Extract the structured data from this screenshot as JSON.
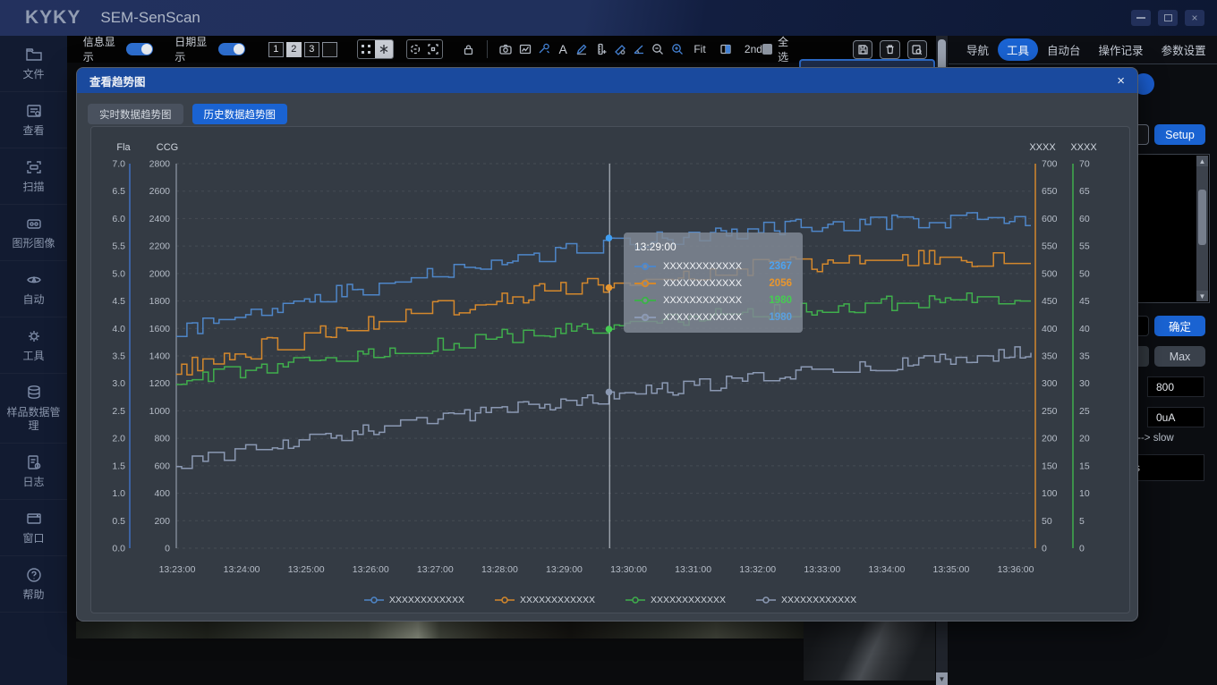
{
  "window": {
    "brand": "KYKY",
    "title": "SEM-SenScan",
    "close_icon": "×"
  },
  "toolbar": {
    "info_toggle_label": "信息显示",
    "date_toggle_label": "日期显示",
    "page_buttons": [
      "1",
      "2",
      "3",
      ""
    ],
    "text_tool_label": "A",
    "fit_label": "Fit",
    "second_label": "2nd",
    "select_all_label": "全选"
  },
  "sidebar": {
    "items": [
      {
        "label": "文件",
        "icon": "folder-icon"
      },
      {
        "label": "查看",
        "icon": "view-icon"
      },
      {
        "label": "扫描",
        "icon": "scan-icon"
      },
      {
        "label": "图形图像",
        "icon": "image-icon"
      },
      {
        "label": "自动",
        "icon": "auto-icon"
      },
      {
        "label": "工具",
        "icon": "gear-icon"
      },
      {
        "label": "样品数据管理",
        "icon": "database-icon"
      },
      {
        "label": "日志",
        "icon": "log-icon"
      },
      {
        "label": "窗口",
        "icon": "window-icon"
      },
      {
        "label": "帮助",
        "icon": "help-icon"
      }
    ]
  },
  "right_tabs": {
    "items": [
      "导航",
      "工具",
      "自动台",
      "操作记录",
      "参数设置"
    ],
    "active": "工具"
  },
  "right_panel": {
    "setup_label": "Setup",
    "confirm_label": "确定",
    "max_label": "Max",
    "voltage_value": "800",
    "current_value": "0uA",
    "slow_label": "-------> slow",
    "partial_input_value": "s",
    "scroll_up_icon": "▲",
    "scroll_down_icon": "▼"
  },
  "dialog": {
    "title": "查看趋势图",
    "close_icon": "×",
    "tabs": [
      {
        "label": "实时数据趋势图",
        "active": false
      },
      {
        "label": "历史数据趋势图",
        "active": true
      }
    ]
  },
  "chart_data": {
    "type": "line",
    "line_style": "step",
    "grid": "dashed-horizontal",
    "axes": {
      "left1": {
        "label": "Fla",
        "color": "#3f6fc0",
        "ticks": [
          "7.0",
          "6.5",
          "6.0",
          "5.5",
          "5.0",
          "4.5",
          "4.0",
          "3.5",
          "3.0",
          "2.5",
          "2.0",
          "1.5",
          "1.0",
          "0.5",
          "0.0"
        ]
      },
      "left2": {
        "label": "CCG",
        "color": "#7e8794",
        "ticks": [
          "2800",
          "2600",
          "2400",
          "2200",
          "2000",
          "1800",
          "1600",
          "1400",
          "1200",
          "1000",
          "800",
          "600",
          "400",
          "200",
          "0"
        ]
      },
      "right1": {
        "label": "XXXX",
        "color": "#d4882c",
        "ticks": [
          "700",
          "650",
          "600",
          "550",
          "500",
          "450",
          "400",
          "350",
          "300",
          "250",
          "200",
          "150",
          "100",
          "50",
          "0"
        ]
      },
      "right2": {
        "label": "XXXX",
        "color": "#3fae4c",
        "ticks": [
          "70",
          "65",
          "60",
          "55",
          "50",
          "45",
          "40",
          "35",
          "30",
          "25",
          "20",
          "15",
          "10",
          "5",
          "0"
        ]
      }
    },
    "x_ticks": [
      "13:23:00",
      "13:24:00",
      "13:25:00",
      "13:26:00",
      "13:27:00",
      "13:28:00",
      "13:29:00",
      "13:30:00",
      "13:31:00",
      "13:32:00",
      "13:33:00",
      "13:34:00",
      "13:35:00",
      "13:36:00"
    ],
    "ylim": [
      0,
      2800
    ],
    "series": [
      {
        "name": "XXXXXXXXXXXX",
        "color": "#4e86c8",
        "dot_color": "#3f9ef2",
        "start": 1570,
        "mid": 2420,
        "end": 2390,
        "jitter": 55,
        "seed": 7
      },
      {
        "name": "XXXXXXXXXXXX",
        "color": "#d4882c",
        "dot_color": "#e8962e",
        "start": 1300,
        "mid": 2150,
        "end": 2110,
        "jitter": 65,
        "seed": 13
      },
      {
        "name": "XXXXXXXXXXXX",
        "color": "#3fae4c",
        "dot_color": "#45cc52",
        "start": 1220,
        "mid": 1715,
        "end": 1830,
        "jitter": 55,
        "seed": 21
      },
      {
        "name": "XXXXXXXXXXXX",
        "color": "#8b99b3",
        "dot_color": "#8b99b3",
        "start": 620,
        "mid": 1175,
        "end": 1430,
        "jitter": 50,
        "seed": 31
      }
    ],
    "crosshair_fraction": 0.507,
    "tooltip": {
      "time": "13:29:00",
      "rows": [
        {
          "label": "XXXXXXXXXXXX",
          "value": "2367",
          "color": "#4da3f0",
          "line_color": "#4e86c8"
        },
        {
          "label": "XXXXXXXXXXXX",
          "value": "2056",
          "color": "#e8962e",
          "line_color": "#d4882c"
        },
        {
          "label": "XXXXXXXXXXXX",
          "value": "1980",
          "color": "#45cc52",
          "line_color": "#3fae4c"
        },
        {
          "label": "XXXXXXXXXXXX",
          "value": "1980",
          "color": "#5aa0e0",
          "line_color": "#8b99b3"
        }
      ]
    },
    "legend": [
      {
        "label": "XXXXXXXXXXXX",
        "color": "#4e86c8"
      },
      {
        "label": "XXXXXXXXXXXX",
        "color": "#d4882c"
      },
      {
        "label": "XXXXXXXXXXXX",
        "color": "#3fae4c"
      },
      {
        "label": "XXXXXXXXXXXX",
        "color": "#8b99b3"
      }
    ]
  }
}
